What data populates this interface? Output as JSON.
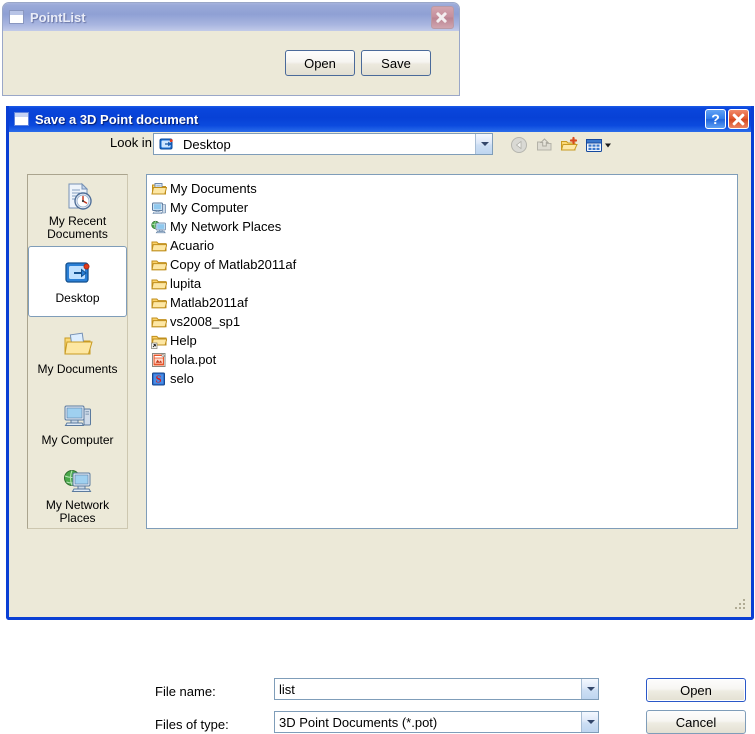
{
  "background_window": {
    "title": "PointList",
    "icon": "window-icon",
    "close_icon": "close-icon",
    "buttons": [
      {
        "label": "Open",
        "name": "open-button"
      },
      {
        "label": "Save",
        "name": "save-button"
      }
    ]
  },
  "dialog": {
    "title": "Save a 3D Point document",
    "icon": "window-icon",
    "help_label": "?",
    "help_icon": "help-icon",
    "close_icon": "close-icon",
    "lookin": {
      "label": "Look in:",
      "value": "Desktop",
      "icon": "desktop-icon"
    },
    "toolbar": [
      {
        "name": "back-icon",
        "label": "Back",
        "enabled": false
      },
      {
        "name": "up-folder-icon",
        "label": "Up One Level",
        "enabled": false
      },
      {
        "name": "new-folder-icon",
        "label": "Create New Folder",
        "enabled": true
      },
      {
        "name": "views-icon",
        "label": "Views",
        "enabled": true
      }
    ],
    "places": [
      {
        "label": "My Recent Documents",
        "icon": "recent-documents-icon",
        "selected": false
      },
      {
        "label": "Desktop",
        "icon": "desktop-icon",
        "selected": true
      },
      {
        "label": "My Documents",
        "icon": "my-documents-icon",
        "selected": false
      },
      {
        "label": "My Computer",
        "icon": "my-computer-icon",
        "selected": false
      },
      {
        "label": "My Network Places",
        "icon": "network-places-icon",
        "selected": false
      }
    ],
    "files": [
      {
        "name": "My Documents",
        "icon": "my-documents-folder-icon"
      },
      {
        "name": "My Computer",
        "icon": "my-computer-icon"
      },
      {
        "name": "My Network Places",
        "icon": "network-places-icon"
      },
      {
        "name": "Acuario",
        "icon": "folder-icon"
      },
      {
        "name": "Copy of Matlab2011af",
        "icon": "folder-icon"
      },
      {
        "name": "lupita",
        "icon": "folder-icon"
      },
      {
        "name": "Matlab2011af",
        "icon": "folder-icon"
      },
      {
        "name": "vs2008_sp1",
        "icon": "folder-icon"
      },
      {
        "name": "Help",
        "icon": "folder-shortcut-icon"
      },
      {
        "name": "hola.pot",
        "icon": "powerpoint-template-icon"
      },
      {
        "name": "selo",
        "icon": "s-file-icon"
      }
    ],
    "filename": {
      "label": "File name:",
      "value": "list",
      "placeholder": ""
    },
    "filetype": {
      "label": "Files of type:",
      "value": "3D Point Documents (*.pot)"
    },
    "buttons": [
      {
        "label": "Open",
        "name": "open-button",
        "default": true
      },
      {
        "label": "Cancel",
        "name": "cancel-button",
        "default": false
      }
    ],
    "resize_grip": "resize-grip"
  },
  "colors": {
    "titlebar_active": "#0a46dc",
    "titlebar_inactive": "#9aa9d8",
    "dialog_face": "#ece9d8",
    "border_blue": "#0a3fd4",
    "field_border": "#7f9db9",
    "folder_yellow": "#fcd66a"
  }
}
